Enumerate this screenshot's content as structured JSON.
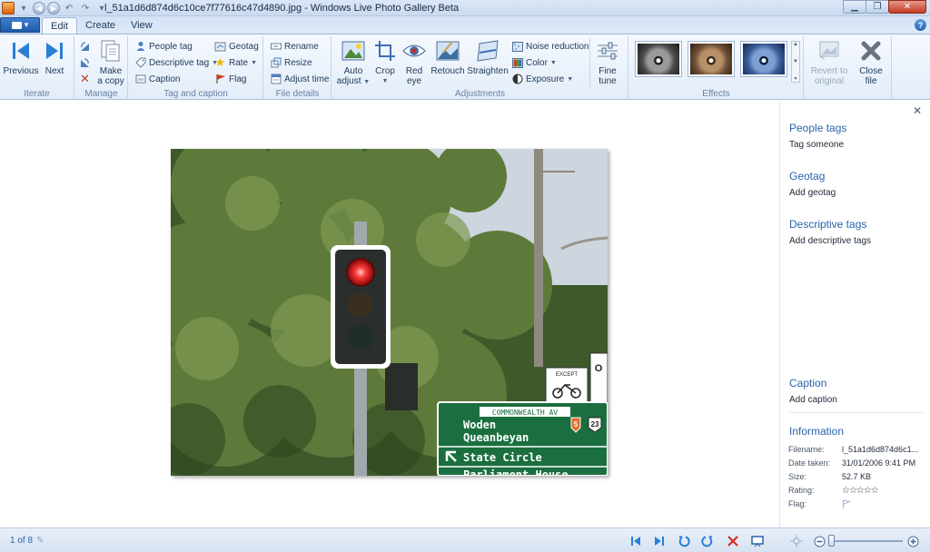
{
  "window": {
    "title": "l_51a1d6d874d6c10ce7f77616c47d4890.jpg - Windows Live Photo Gallery Beta",
    "help_label": "?"
  },
  "tabs": [
    {
      "label": "Edit",
      "active": true
    },
    {
      "label": "Create",
      "active": false
    },
    {
      "label": "View",
      "active": false
    }
  ],
  "ribbon": {
    "iterate": {
      "label": "Iterate",
      "previous": "Previous",
      "next": "Next"
    },
    "manage": {
      "label": "Manage",
      "make_copy_1": "Make",
      "make_copy_2": "a copy"
    },
    "tag_caption": {
      "label": "Tag and caption",
      "people_tag": "People tag",
      "descriptive_tag": "Descriptive tag",
      "caption": "Caption",
      "geotag": "Geotag",
      "rate": "Rate",
      "flag": "Flag"
    },
    "file_details": {
      "label": "File details",
      "rename": "Rename",
      "resize": "Resize",
      "adjust_time": "Adjust time"
    },
    "adjustments": {
      "label": "Adjustments",
      "auto_adjust_1": "Auto",
      "auto_adjust_2": "adjust",
      "crop": "Crop",
      "red_eye_1": "Red",
      "red_eye_2": "eye",
      "retouch": "Retouch",
      "straighten": "Straighten",
      "noise_reduction": "Noise reduction",
      "color": "Color",
      "exposure": "Exposure",
      "fine_tune_1": "Fine",
      "fine_tune_2": "tune"
    },
    "effects": {
      "label": "Effects",
      "revert_1": "Revert to",
      "revert_2": "original",
      "close_1": "Close",
      "close_2": "file"
    }
  },
  "side_pane": {
    "people_tags": "People tags",
    "tag_someone": "Tag someone",
    "geotag": "Geotag",
    "add_geotag": "Add geotag",
    "descriptive_tags": "Descriptive tags",
    "add_descriptive_tags": "Add descriptive tags",
    "caption": "Caption",
    "add_caption": "Add caption",
    "information": "Information",
    "info": [
      {
        "key": "Filename:",
        "value": "l_51a1d6d874d6c1..."
      },
      {
        "key": "Date taken:",
        "value": "31/01/2006  9:41 PM"
      },
      {
        "key": "Size:",
        "value": "52.7 KB"
      },
      {
        "key": "Rating:",
        "value": "☆☆☆☆☆"
      },
      {
        "key": "Flag:",
        "value": ""
      }
    ]
  },
  "photo": {
    "sign_top": "COMMONWEALTH AV",
    "sign_line1": "Woden",
    "sign_line2": "Queanbeyan",
    "sign_line3": "State Circle",
    "sign_line4": "Parliament House",
    "route_a": "5",
    "route_b": "23",
    "bike_sign_top": "EXCEPT",
    "side_sign": "O"
  },
  "status": {
    "count": "1 of 8"
  },
  "colors": {
    "accent": "#2a64a8",
    "ribbon_bg": "#e3edf9",
    "close_red": "#c23a22",
    "sign_green": "#1b6f3f"
  }
}
